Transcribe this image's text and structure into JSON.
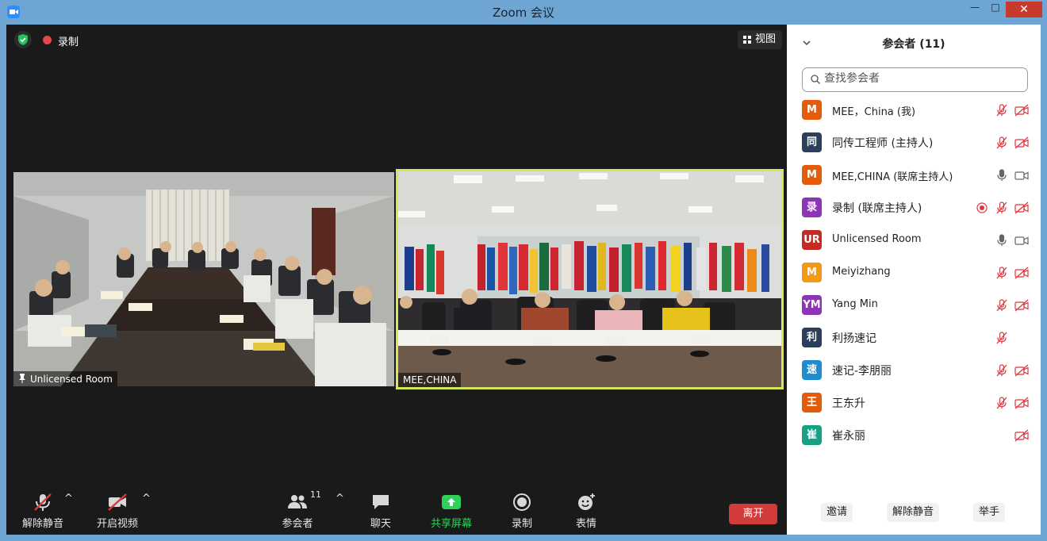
{
  "window": {
    "title": "Zoom 会议",
    "minimize": "—",
    "maximize": "□",
    "close": "✕"
  },
  "meeting": {
    "recording_label": "录制",
    "view_label": "视图",
    "tiles": [
      {
        "name": "Unlicensed Room"
      },
      {
        "name": "MEE,CHINA"
      }
    ]
  },
  "toolbar": {
    "unmute": "解除静音",
    "start_video": "开启视频",
    "participants": "参会者",
    "participants_count": "11",
    "chat": "聊天",
    "share": "共享屏幕",
    "record": "录制",
    "reactions": "表情",
    "leave": "离开"
  },
  "panel": {
    "title": "参会者 (11)",
    "search_placeholder": "查找参会者",
    "participants": [
      {
        "initials": "M",
        "name": "MEE，China (我)",
        "color": "#e35c0c",
        "mic": "muted",
        "cam": "off",
        "rec": false,
        "bigname": false
      },
      {
        "initials": "同",
        "name": "同传工程师 (主持人)",
        "color": "#2b3f5c",
        "mic": "muted",
        "cam": "off",
        "rec": false,
        "bigname": true
      },
      {
        "initials": "M",
        "name": "MEE,CHINA (联席主持人)",
        "color": "#e35c0c",
        "mic": "on",
        "cam": "on",
        "rec": false,
        "bigname": false
      },
      {
        "initials": "录",
        "name": "录制 (联席主持人)",
        "color": "#8d34b7",
        "mic": "muted",
        "cam": "off",
        "rec": true,
        "bigname": true
      },
      {
        "initials": "UR",
        "name": "Unlicensed Room",
        "color": "#c42b25",
        "mic": "on",
        "cam": "on",
        "rec": false,
        "bigname": false
      },
      {
        "initials": "M",
        "name": "Meiyizhang",
        "color": "#f39a12",
        "mic": "muted",
        "cam": "off",
        "rec": false,
        "bigname": false
      },
      {
        "initials": "YM",
        "name": "Yang Min",
        "color": "#8d34b7",
        "mic": "muted",
        "cam": "off",
        "rec": false,
        "bigname": false
      },
      {
        "initials": "利",
        "name": "利扬速记",
        "color": "#2b3f5c",
        "mic": "muted",
        "cam": "none",
        "rec": false,
        "bigname": true
      },
      {
        "initials": "速",
        "name": "速记-李朋丽",
        "color": "#1f8ccf",
        "mic": "muted",
        "cam": "off",
        "rec": false,
        "bigname": true
      },
      {
        "initials": "王",
        "name": "王东升",
        "color": "#e35c0c",
        "mic": "muted",
        "cam": "off",
        "rec": false,
        "bigname": true
      },
      {
        "initials": "崔",
        "name": "崔永丽",
        "color": "#17a184",
        "mic": "none",
        "cam": "off",
        "rec": false,
        "bigname": true
      }
    ],
    "invite": "邀请",
    "unmute_me": "解除静音",
    "raise_hand": "举手"
  },
  "colors": {
    "accent_share": "#2fd15a",
    "leave": "#d33a3a",
    "speaker_border": "#d6e75a",
    "muted_red": "#d9363e"
  }
}
